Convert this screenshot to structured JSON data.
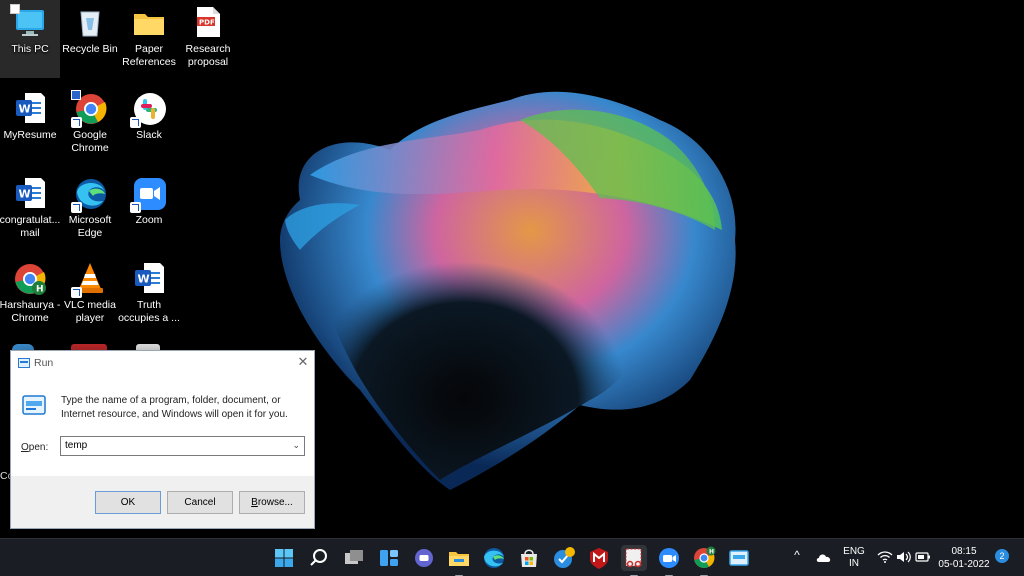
{
  "desktop": {
    "icons": [
      {
        "label": "This PC",
        "icon": "monitor-icon"
      },
      {
        "label": "Recycle Bin",
        "icon": "recycle-bin-icon"
      },
      {
        "label": "Paper References",
        "icon": "folder-icon"
      },
      {
        "label": "Research proposal",
        "icon": "pdf-icon"
      },
      {
        "label": "MyResume",
        "icon": "word-doc-icon"
      },
      {
        "label": "Google Chrome",
        "icon": "chrome-icon"
      },
      {
        "label": "Slack",
        "icon": "slack-icon"
      },
      {
        "label": "congratulat... mail",
        "icon": "word-doc-icon"
      },
      {
        "label": "Microsoft Edge",
        "icon": "edge-icon"
      },
      {
        "label": "Zoom",
        "icon": "zoom-icon"
      },
      {
        "label": "Harshaurya - Chrome",
        "icon": "chrome-profile-icon"
      },
      {
        "label": "VLC media player",
        "icon": "vlc-icon"
      },
      {
        "label": "Truth occupies a ...",
        "icon": "word-doc-icon"
      }
    ],
    "partial_label": "Co"
  },
  "run_dialog": {
    "title": "Run",
    "description": "Type the name of a program, folder, document, or Internet resource, and Windows will open it for you.",
    "open_label_underlined": "O",
    "open_label_rest": "pen:",
    "input_value": "temp",
    "ok_label": "OK",
    "cancel_label": "Cancel",
    "browse_label_underlined": "B",
    "browse_label_rest": "rowse...",
    "close_glyph": "✕",
    "dropdown_glyph": "⌄"
  },
  "taskbar": {
    "apps": [
      "start-icon",
      "search-icon",
      "task-view-icon",
      "widgets-icon",
      "teams-chat-icon",
      "file-explorer-icon",
      "edge-icon",
      "store-icon",
      "update-badge-icon",
      "mcafee-icon",
      "snipping-tool-icon",
      "zoom-icon",
      "chrome-profile-icon",
      "run-icon"
    ],
    "tray": {
      "chevron": "^",
      "language_line1": "ENG",
      "language_line2": "IN",
      "time": "08:15",
      "date": "05-01-2022",
      "notifications": "2"
    }
  },
  "colors": {
    "taskbar_bg": "#1a1d23",
    "accent": "#0078d4"
  }
}
